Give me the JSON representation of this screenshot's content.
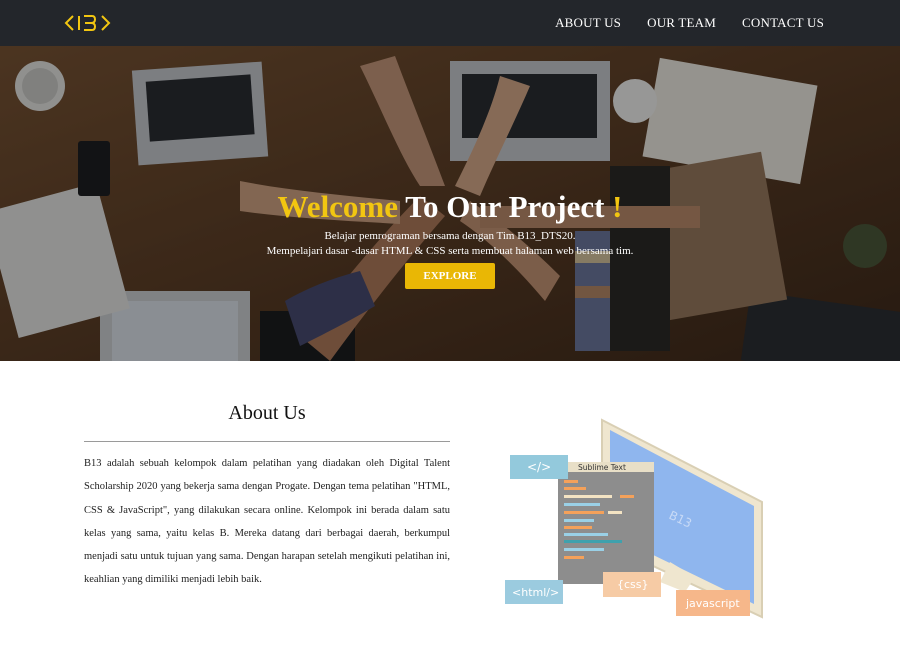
{
  "nav": {
    "logo_text": "<B>",
    "links": [
      {
        "label": "ABOUT US"
      },
      {
        "label": "OUR TEAM"
      },
      {
        "label": "CONTACT US"
      }
    ]
  },
  "hero": {
    "title_accent": "Welcome",
    "title_main": " To Our Project ",
    "title_end": "!",
    "subtitle_line1": "Belajar pemrograman bersama dengan Tim B13_DTS20.",
    "subtitle_line2": "Mempelajari dasar -dasar HTML & CSS serta membuat halaman web bersama tim.",
    "button_label": "EXPLORE"
  },
  "about": {
    "title": "About Us",
    "body": "B13 adalah sebuah kelompok dalam pelatihan yang diadakan oleh Digital Talent Scholarship 2020 yang bekerja sama dengan Progate. Dengan tema pelatihan \"HTML, CSS & JavaScript\", yang dilakukan secara online. Kelompok ini berada dalam satu kelas yang sama, yaitu kelas B. Mereka datang dari berbagai daerah, berkumpul menjadi satu untuk tujuan yang sama. Dengan harapan setelah mengikuti pelatihan ini, keahlian yang dimiliki menjadi lebih baik."
  },
  "illustration": {
    "monitor_label": "B13",
    "editor_title": "Sublime Text",
    "tag_code": "</>",
    "tag_css": "{css}",
    "tag_html": "<html/>",
    "tag_js": "javascript"
  },
  "colors": {
    "navbar_bg": "#23262b",
    "accent_yellow": "#f2c611",
    "button_bg": "#e9b705"
  }
}
